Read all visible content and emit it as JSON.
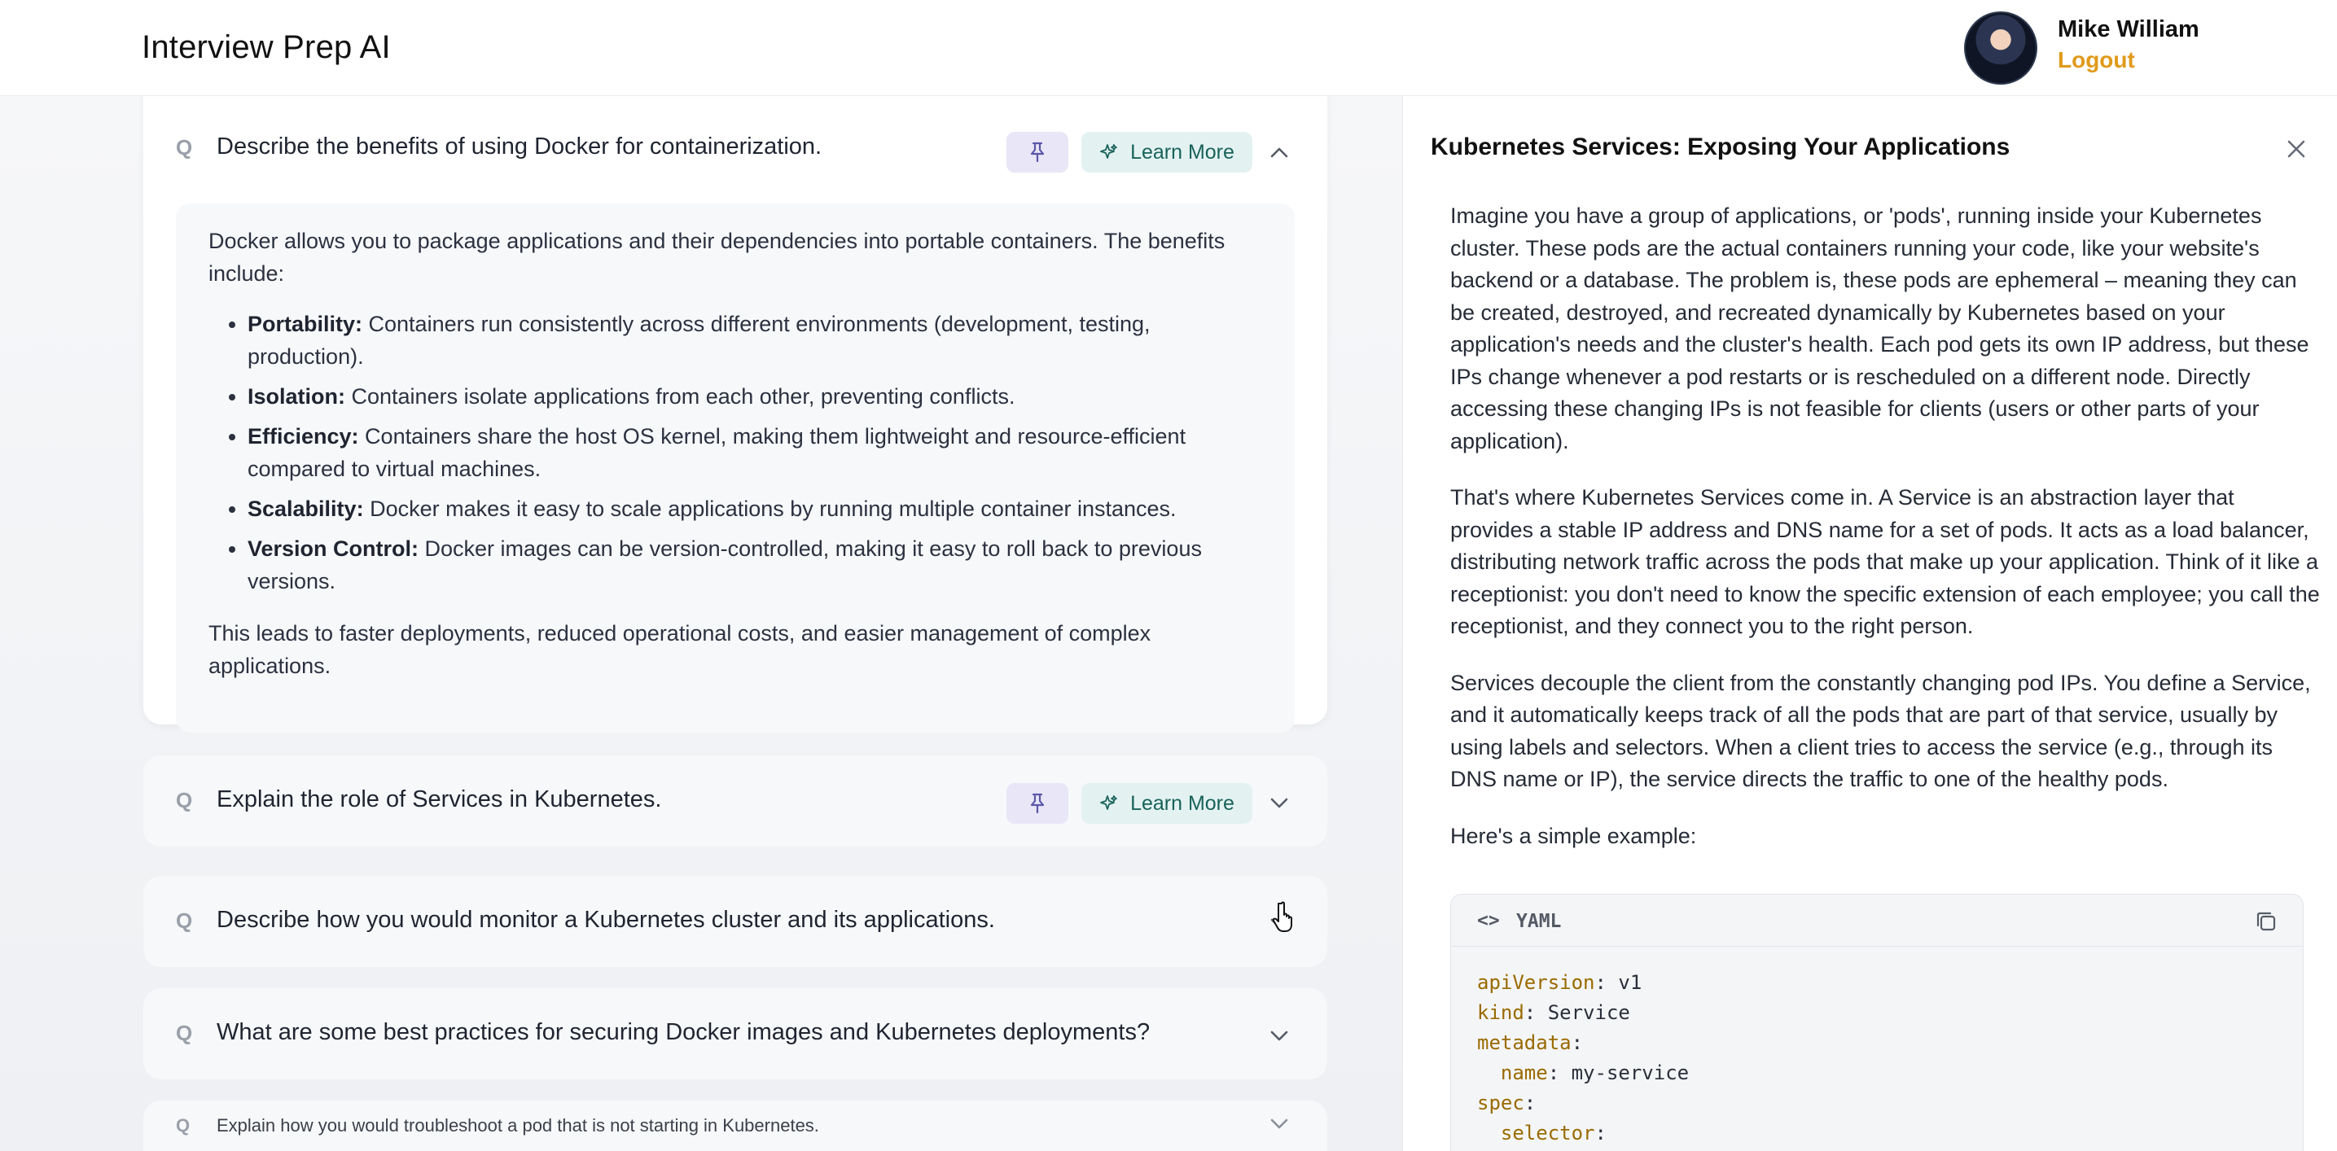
{
  "header": {
    "app_title": "Interview Prep AI",
    "user_name": "Mike William",
    "logout_label": "Logout"
  },
  "questions": [
    {
      "q_mark": "Q",
      "text": "Describe the benefits of using Docker for containerization.",
      "learn_more": "Learn More",
      "expanded": true,
      "answer": {
        "intro": "Docker allows you to package applications and their dependencies into portable containers. The benefits include:",
        "bullets": [
          {
            "term": "Portability:",
            "text": " Containers run consistently across different environments (development, testing, production)."
          },
          {
            "term": "Isolation:",
            "text": " Containers isolate applications from each other, preventing conflicts."
          },
          {
            "term": "Efficiency:",
            "text": " Containers share the host OS kernel, making them lightweight and resource-efficient compared to virtual machines."
          },
          {
            "term": "Scalability:",
            "text": " Docker makes it easy to scale applications by running multiple container instances."
          },
          {
            "term": "Version Control:",
            "text": " Docker images can be version-controlled, making it easy to roll back to previous versions."
          }
        ],
        "outro": "This leads to faster deployments, reduced operational costs, and easier management of complex applications."
      }
    },
    {
      "q_mark": "Q",
      "text": "Explain the role of Services in Kubernetes.",
      "learn_more": "Learn More",
      "expanded": false
    },
    {
      "q_mark": "Q",
      "text": "Describe how you would monitor a Kubernetes cluster and its applications.",
      "expanded": false
    },
    {
      "q_mark": "Q",
      "text": "What are some best practices for securing Docker images and Kubernetes deployments?",
      "expanded": false
    },
    {
      "q_mark": "Q",
      "text": "Explain how you would troubleshoot a pod that is not starting in Kubernetes.",
      "expanded": false
    }
  ],
  "drawer": {
    "title": "Kubernetes Services: Exposing Your Applications",
    "paragraphs": [
      "Imagine you have a group of applications, or 'pods', running inside your Kubernetes cluster. These pods are the actual containers running your code, like your website's backend or a database. The problem is, these pods are ephemeral – meaning they can be created, destroyed, and recreated dynamically by Kubernetes based on your application's needs and the cluster's health. Each pod gets its own IP address, but these IPs change whenever a pod restarts or is rescheduled on a different node. Directly accessing these changing IPs is not feasible for clients (users or other parts of your application).",
      "That's where Kubernetes Services come in. A Service is an abstraction layer that provides a stable IP address and DNS name for a set of pods. It acts as a load balancer, distributing network traffic across the pods that make up your application. Think of it like a receptionist: you don't need to know the specific extension of each employee; you call the receptionist, and they connect you to the right person.",
      "Services decouple the client from the constantly changing pod IPs. You define a Service, and it automatically keeps track of all the pods that are part of that service, usually by using labels and selectors. When a client tries to access the service (e.g., through its DNS name or IP), the service directs the traffic to one of the healthy pods.",
      "Here's a simple example:"
    ],
    "code": {
      "language": "YAML",
      "lines": [
        {
          "key": "apiVersion",
          "value": " v1",
          "indent": ""
        },
        {
          "key": "kind",
          "value": " Service",
          "indent": ""
        },
        {
          "key": "metadata",
          "value": "",
          "indent": ""
        },
        {
          "key": "name",
          "value": " my-service",
          "indent": "  "
        },
        {
          "key": "spec",
          "value": "",
          "indent": ""
        },
        {
          "key": "selector",
          "value": "",
          "indent": "  "
        }
      ]
    }
  },
  "colors": {
    "accent_orange": "#e09a1a",
    "learn_more_bg": "#e3f2f1",
    "pin_bg": "#e8e6f7"
  }
}
